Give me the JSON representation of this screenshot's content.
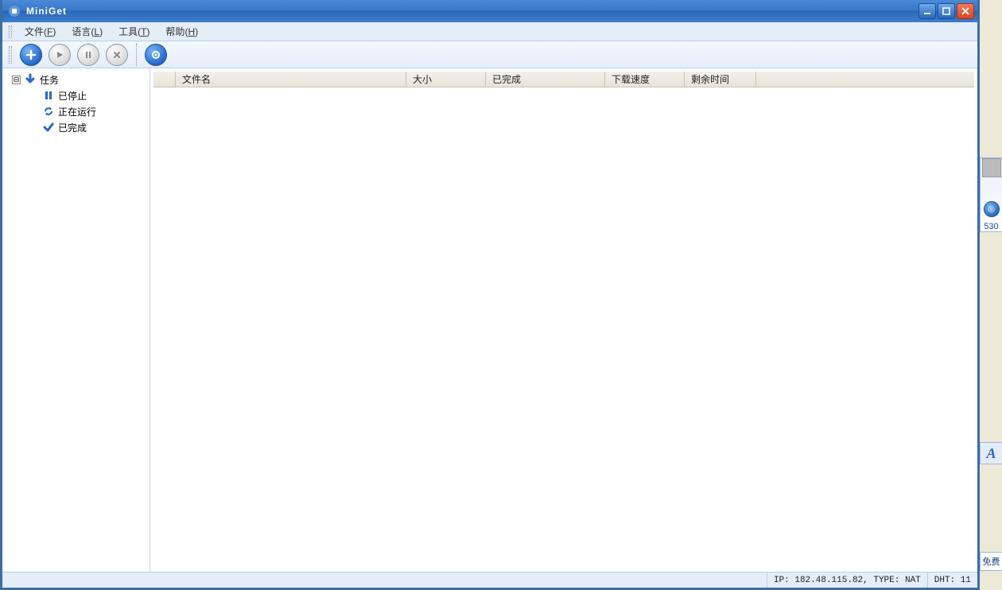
{
  "title": "MiniGet",
  "menu": {
    "file": {
      "label": "文件",
      "hotkey": "F"
    },
    "language": {
      "label": "语言",
      "hotkey": "L"
    },
    "tools": {
      "label": "工具",
      "hotkey": "T"
    },
    "help": {
      "label": "帮助",
      "hotkey": "H"
    }
  },
  "tree": {
    "expander": "⊟",
    "root_label": "任务",
    "children": [
      {
        "label": "已停止"
      },
      {
        "label": "正在运行"
      },
      {
        "label": "已完成"
      }
    ]
  },
  "columns": {
    "filename": "文件名",
    "size": "大小",
    "completed": "已完成",
    "speed": "下载速度",
    "remaining": "剩余时间"
  },
  "status": {
    "ip": "IP: 182.48.115.82, TYPE: NAT",
    "dht": "DHT: 11"
  },
  "floater": {
    "num": "530",
    "a_label": "A",
    "free_label": "免费"
  }
}
